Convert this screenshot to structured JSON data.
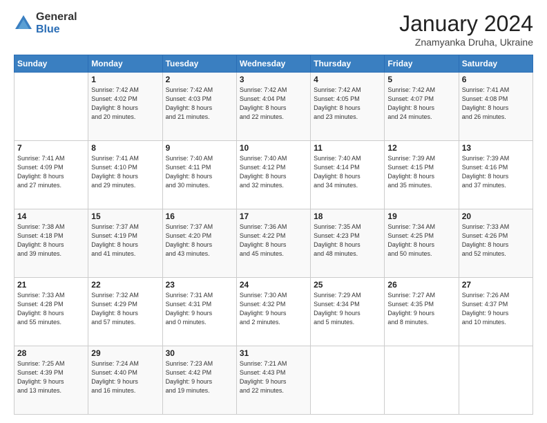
{
  "logo": {
    "general": "General",
    "blue": "Blue"
  },
  "header": {
    "month": "January 2024",
    "location": "Znamyanka Druha, Ukraine"
  },
  "days_of_week": [
    "Sunday",
    "Monday",
    "Tuesday",
    "Wednesday",
    "Thursday",
    "Friday",
    "Saturday"
  ],
  "weeks": [
    [
      {
        "day": "",
        "info": ""
      },
      {
        "day": "1",
        "info": "Sunrise: 7:42 AM\nSunset: 4:02 PM\nDaylight: 8 hours\nand 20 minutes."
      },
      {
        "day": "2",
        "info": "Sunrise: 7:42 AM\nSunset: 4:03 PM\nDaylight: 8 hours\nand 21 minutes."
      },
      {
        "day": "3",
        "info": "Sunrise: 7:42 AM\nSunset: 4:04 PM\nDaylight: 8 hours\nand 22 minutes."
      },
      {
        "day": "4",
        "info": "Sunrise: 7:42 AM\nSunset: 4:05 PM\nDaylight: 8 hours\nand 23 minutes."
      },
      {
        "day": "5",
        "info": "Sunrise: 7:42 AM\nSunset: 4:07 PM\nDaylight: 8 hours\nand 24 minutes."
      },
      {
        "day": "6",
        "info": "Sunrise: 7:41 AM\nSunset: 4:08 PM\nDaylight: 8 hours\nand 26 minutes."
      }
    ],
    [
      {
        "day": "7",
        "info": "Sunrise: 7:41 AM\nSunset: 4:09 PM\nDaylight: 8 hours\nand 27 minutes."
      },
      {
        "day": "8",
        "info": "Sunrise: 7:41 AM\nSunset: 4:10 PM\nDaylight: 8 hours\nand 29 minutes."
      },
      {
        "day": "9",
        "info": "Sunrise: 7:40 AM\nSunset: 4:11 PM\nDaylight: 8 hours\nand 30 minutes."
      },
      {
        "day": "10",
        "info": "Sunrise: 7:40 AM\nSunset: 4:12 PM\nDaylight: 8 hours\nand 32 minutes."
      },
      {
        "day": "11",
        "info": "Sunrise: 7:40 AM\nSunset: 4:14 PM\nDaylight: 8 hours\nand 34 minutes."
      },
      {
        "day": "12",
        "info": "Sunrise: 7:39 AM\nSunset: 4:15 PM\nDaylight: 8 hours\nand 35 minutes."
      },
      {
        "day": "13",
        "info": "Sunrise: 7:39 AM\nSunset: 4:16 PM\nDaylight: 8 hours\nand 37 minutes."
      }
    ],
    [
      {
        "day": "14",
        "info": "Sunrise: 7:38 AM\nSunset: 4:18 PM\nDaylight: 8 hours\nand 39 minutes."
      },
      {
        "day": "15",
        "info": "Sunrise: 7:37 AM\nSunset: 4:19 PM\nDaylight: 8 hours\nand 41 minutes."
      },
      {
        "day": "16",
        "info": "Sunrise: 7:37 AM\nSunset: 4:20 PM\nDaylight: 8 hours\nand 43 minutes."
      },
      {
        "day": "17",
        "info": "Sunrise: 7:36 AM\nSunset: 4:22 PM\nDaylight: 8 hours\nand 45 minutes."
      },
      {
        "day": "18",
        "info": "Sunrise: 7:35 AM\nSunset: 4:23 PM\nDaylight: 8 hours\nand 48 minutes."
      },
      {
        "day": "19",
        "info": "Sunrise: 7:34 AM\nSunset: 4:25 PM\nDaylight: 8 hours\nand 50 minutes."
      },
      {
        "day": "20",
        "info": "Sunrise: 7:33 AM\nSunset: 4:26 PM\nDaylight: 8 hours\nand 52 minutes."
      }
    ],
    [
      {
        "day": "21",
        "info": "Sunrise: 7:33 AM\nSunset: 4:28 PM\nDaylight: 8 hours\nand 55 minutes."
      },
      {
        "day": "22",
        "info": "Sunrise: 7:32 AM\nSunset: 4:29 PM\nDaylight: 8 hours\nand 57 minutes."
      },
      {
        "day": "23",
        "info": "Sunrise: 7:31 AM\nSunset: 4:31 PM\nDaylight: 9 hours\nand 0 minutes."
      },
      {
        "day": "24",
        "info": "Sunrise: 7:30 AM\nSunset: 4:32 PM\nDaylight: 9 hours\nand 2 minutes."
      },
      {
        "day": "25",
        "info": "Sunrise: 7:29 AM\nSunset: 4:34 PM\nDaylight: 9 hours\nand 5 minutes."
      },
      {
        "day": "26",
        "info": "Sunrise: 7:27 AM\nSunset: 4:35 PM\nDaylight: 9 hours\nand 8 minutes."
      },
      {
        "day": "27",
        "info": "Sunrise: 7:26 AM\nSunset: 4:37 PM\nDaylight: 9 hours\nand 10 minutes."
      }
    ],
    [
      {
        "day": "28",
        "info": "Sunrise: 7:25 AM\nSunset: 4:39 PM\nDaylight: 9 hours\nand 13 minutes."
      },
      {
        "day": "29",
        "info": "Sunrise: 7:24 AM\nSunset: 4:40 PM\nDaylight: 9 hours\nand 16 minutes."
      },
      {
        "day": "30",
        "info": "Sunrise: 7:23 AM\nSunset: 4:42 PM\nDaylight: 9 hours\nand 19 minutes."
      },
      {
        "day": "31",
        "info": "Sunrise: 7:21 AM\nSunset: 4:43 PM\nDaylight: 9 hours\nand 22 minutes."
      },
      {
        "day": "",
        "info": ""
      },
      {
        "day": "",
        "info": ""
      },
      {
        "day": "",
        "info": ""
      }
    ]
  ]
}
